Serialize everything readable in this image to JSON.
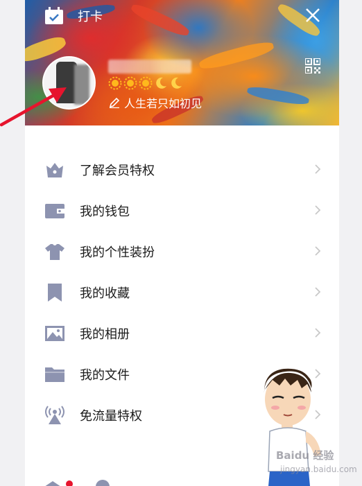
{
  "header": {
    "checkin_label": "打卡",
    "signature": "人生若只如初见"
  },
  "menu": {
    "items": [
      {
        "label": "了解会员特权",
        "icon": "crown-icon"
      },
      {
        "label": "我的钱包",
        "icon": "wallet-icon"
      },
      {
        "label": "我的个性装扮",
        "icon": "tshirt-icon"
      },
      {
        "label": "我的收藏",
        "icon": "bookmark-icon"
      },
      {
        "label": "我的相册",
        "icon": "image-icon"
      },
      {
        "label": "我的文件",
        "icon": "folder-icon"
      },
      {
        "label": "免流量特权",
        "icon": "antenna-icon"
      }
    ]
  },
  "watermark": {
    "brand": "Baidu 经验",
    "url": "jingyan.baidu.com"
  },
  "colors": {
    "icon_gray": "#8d93b0",
    "text": "#1b1b1b",
    "chevron": "#c8c8c8",
    "arrow_red": "#e6142d"
  }
}
